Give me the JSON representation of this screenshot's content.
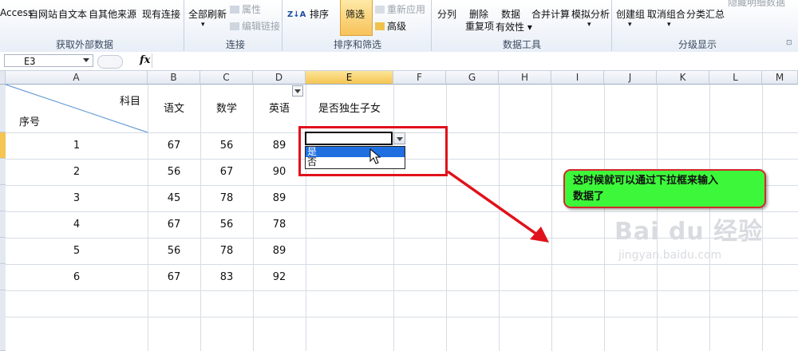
{
  "ribbon": {
    "get_external": {
      "buttons": [
        "Access",
        "自网站",
        "自文本",
        "自其他来源",
        "现有连接"
      ],
      "label": "获取外部数据"
    },
    "connections": {
      "refresh_all": "全部刷新",
      "properties": "属性",
      "edit_links": "编辑链接",
      "label": "连接"
    },
    "sort_filter": {
      "sort_az_icon": "Z↓A",
      "sort": "排序",
      "filter": "筛选",
      "reapply": "重新应用",
      "advanced": "高级",
      "label": "排序和筛选"
    },
    "data_tools": {
      "text_to_columns": "分列",
      "remove_duplicates_1": "删除",
      "remove_duplicates_2": "重复项",
      "validation_1": "数据",
      "validation_2": "有效性",
      "consolidate": "合并计算",
      "what_if": "模拟分析",
      "label": "数据工具"
    },
    "outline": {
      "group": "创建组",
      "ungroup": "取消组合",
      "subtotal": "分类汇总",
      "hide_detail": "隐藏明细数据",
      "label": "分级显示"
    },
    "accent_color": "#f7c25a"
  },
  "formula_bar": {
    "name_box": "E3",
    "fx": "fx"
  },
  "sheet": {
    "columns": [
      "A",
      "B",
      "C",
      "D",
      "E",
      "F",
      "G",
      "H",
      "I",
      "J",
      "K",
      "L",
      "M"
    ],
    "selected_column": "E",
    "header_row": {
      "a_top": "科目",
      "a_bottom": "序号",
      "b": "语文",
      "c": "数学",
      "d": "英语",
      "e": "是否独生子女"
    },
    "rows": [
      {
        "seq": "1",
        "chinese": "67",
        "math": "56",
        "english": "89"
      },
      {
        "seq": "2",
        "chinese": "56",
        "math": "67",
        "english": "90"
      },
      {
        "seq": "3",
        "chinese": "45",
        "math": "78",
        "english": "89"
      },
      {
        "seq": "4",
        "chinese": "67",
        "math": "56",
        "english": "78"
      },
      {
        "seq": "5",
        "chinese": "56",
        "math": "78",
        "english": "89"
      },
      {
        "seq": "6",
        "chinese": "67",
        "math": "83",
        "english": "92"
      }
    ]
  },
  "dropdown": {
    "options": [
      "是",
      "否"
    ],
    "highlighted": "是"
  },
  "annotation": {
    "callout_line1": "这时候就可以通过下拉框来输入",
    "callout_line2": "数据了",
    "callout_color": "#3df83a",
    "border_color": "#e0121b"
  },
  "watermark": {
    "logo": "Bai du 经验",
    "url": "jingyan.baidu.com"
  }
}
